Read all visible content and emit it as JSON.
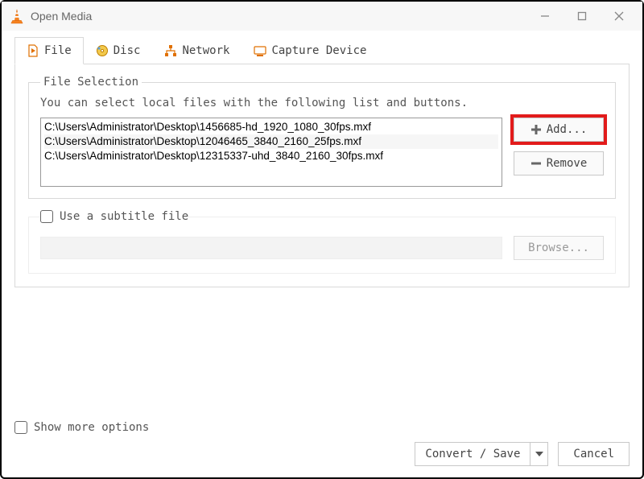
{
  "window": {
    "title": "Open Media"
  },
  "tabs": {
    "file": "File",
    "disc": "Disc",
    "network": "Network",
    "capture": "Capture Device"
  },
  "file_selection": {
    "legend": "File Selection",
    "hint": "You can select local files with the following list and buttons.",
    "files": [
      "C:\\Users\\Administrator\\Desktop\\1456685-hd_1920_1080_30fps.mxf",
      "C:\\Users\\Administrator\\Desktop\\12046465_3840_2160_25fps.mxf",
      "C:\\Users\\Administrator\\Desktop\\12315337-uhd_3840_2160_30fps.mxf"
    ],
    "add_label": "Add...",
    "remove_label": "Remove"
  },
  "subtitle": {
    "checkbox_label": "Use a subtitle file",
    "browse_label": "Browse..."
  },
  "bottom": {
    "show_more": "Show more options",
    "convert_save": "Convert / Save",
    "cancel": "Cancel"
  }
}
